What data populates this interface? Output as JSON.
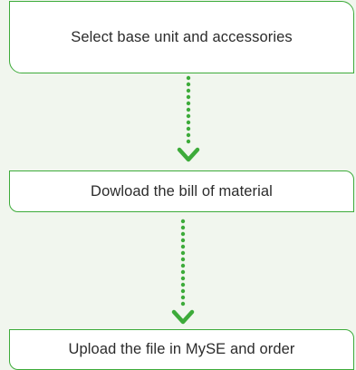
{
  "flow": {
    "steps": [
      {
        "label": "Select base unit and accessories"
      },
      {
        "label": "Dowload the bill of material"
      },
      {
        "label": "Upload the file in MySE and order"
      }
    ],
    "connector_color": "#3dab3a",
    "box_border_color": "#3dab3a",
    "arrow_icon": "chevron-down-icon"
  }
}
